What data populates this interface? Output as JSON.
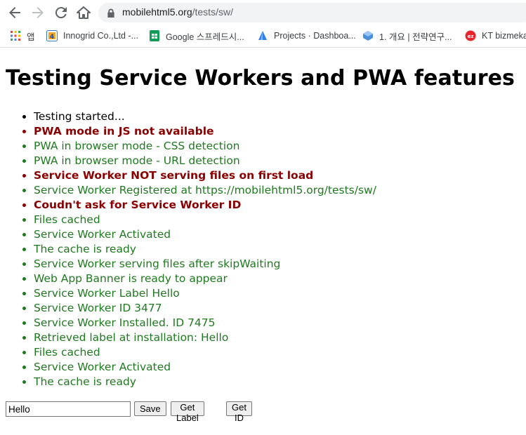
{
  "browser": {
    "url_host": "mobilehtml5.org",
    "url_path": "/tests/sw/"
  },
  "bookmarks": [
    {
      "label": "앱",
      "icon": "apps-grid-icon"
    },
    {
      "label": "Innogrid Co.,Ltd -...",
      "icon": "innogrid-icon"
    },
    {
      "label": "Google 스프레드시...",
      "icon": "google-sheets-icon"
    },
    {
      "label": "Projects · Dashboa...",
      "icon": "projects-icon"
    },
    {
      "label": "1. 개요 | 전략연구...",
      "icon": "cube-icon"
    },
    {
      "label": "KT bizmeka",
      "icon": "kt-bizmeka-icon"
    }
  ],
  "page": {
    "title": "Testing Service Workers and PWA features",
    "log": [
      {
        "text": "Testing started...",
        "status": "info"
      },
      {
        "text": "PWA mode in JS not available",
        "status": "err"
      },
      {
        "text": "PWA in browser mode - CSS detection",
        "status": "ok"
      },
      {
        "text": "PWA in browser mode - URL detection",
        "status": "ok"
      },
      {
        "text": "Service Worker NOT serving files on first load",
        "status": "err"
      },
      {
        "text": "Service Worker Registered at https://mobilehtml5.org/tests/sw/",
        "status": "ok"
      },
      {
        "text": "Coudn't ask for Service Worker ID",
        "status": "err"
      },
      {
        "text": "Files cached",
        "status": "ok"
      },
      {
        "text": "Service Worker Activated",
        "status": "ok"
      },
      {
        "text": "The cache is ready",
        "status": "ok"
      },
      {
        "text": "Service Worker serving files after skipWaiting",
        "status": "ok"
      },
      {
        "text": "Web App Banner is ready to appear",
        "status": "ok"
      },
      {
        "text": "Service Worker Label Hello",
        "status": "ok"
      },
      {
        "text": "Service Worker ID 3477",
        "status": "ok"
      },
      {
        "text": "Service Worker Installed. ID 7475",
        "status": "ok"
      },
      {
        "text": "Retrieved label at installation: Hello",
        "status": "ok"
      },
      {
        "text": "Files cached",
        "status": "ok"
      },
      {
        "text": "Service Worker Activated",
        "status": "ok"
      },
      {
        "text": "The cache is ready",
        "status": "ok"
      }
    ],
    "label_input_value": "Hello",
    "save_label": "Save",
    "get_label_label": "Get Label",
    "get_id_label": "Get ID"
  },
  "colors": {
    "ok": "#1f7a1f",
    "err": "#8b0000",
    "info": "#000000"
  }
}
